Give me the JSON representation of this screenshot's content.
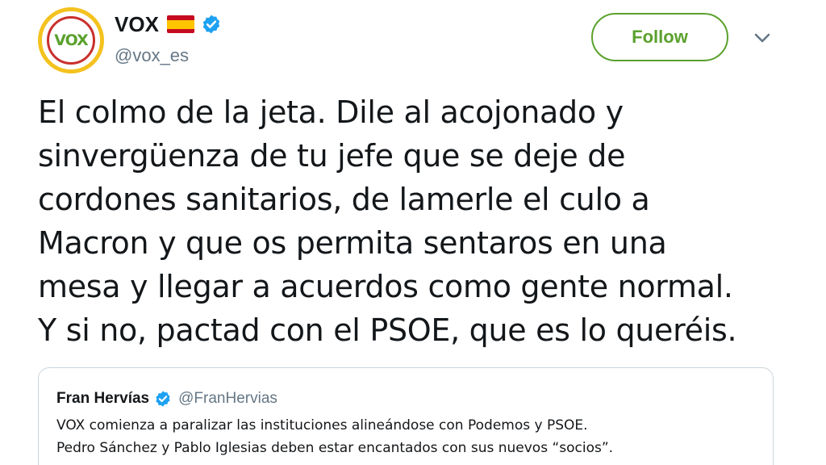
{
  "author": {
    "display_name": "VOX",
    "handle": "@vox_es",
    "avatar_text": "VOX",
    "flag_icon": "spain-flag-icon",
    "verified_icon": "verified-badge-icon"
  },
  "actions": {
    "follow_label": "Follow",
    "menu_icon": "chevron-down-icon"
  },
  "tweet": {
    "lines": [
      "El colmo de la jeta. Dile al acojonado y",
      "sinvergüenza de tu jefe que se deje de",
      "cordones sanitarios, de lamerle el culo a",
      "Macron y que os permita sentaros en una",
      "mesa y llegar a acuerdos como gente normal.",
      "Y si no, pactad con el PSOE, que es lo queréis."
    ]
  },
  "quoted_tweet": {
    "display_name": "Fran Hervías",
    "handle": "@FranHervias",
    "verified_icon": "verified-badge-icon",
    "lines": [
      "VOX comienza a paralizar las instituciones alineándose con Podemos y PSOE.",
      "Pedro Sánchez y Pablo Iglesias deben estar encantados con sus nuevos “socios”."
    ]
  },
  "colors": {
    "brand_green": "#5ba12d",
    "verified_blue": "#1da1f2",
    "text": "#14171a",
    "muted": "#657786",
    "border": "#ccd6dd"
  }
}
